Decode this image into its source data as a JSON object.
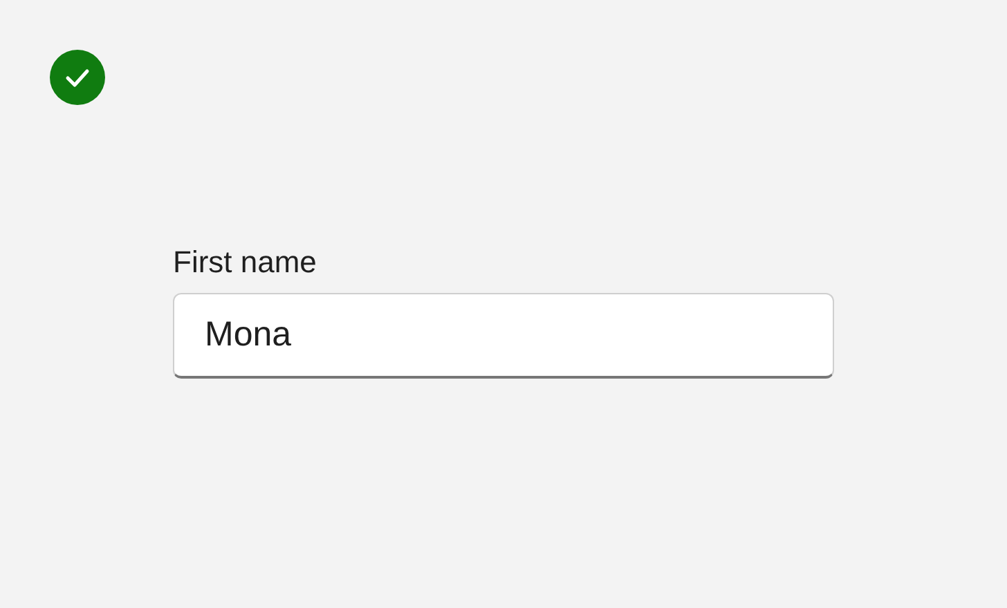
{
  "field": {
    "label": "First name",
    "value": "Mona"
  }
}
